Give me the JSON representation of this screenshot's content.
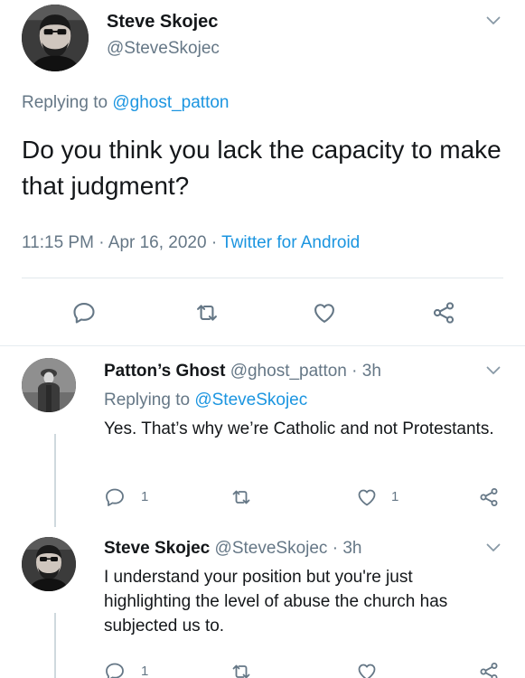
{
  "main_tweet": {
    "name": "Steve Skojec",
    "handle": "@SteveSkojec",
    "replying_prefix": "Replying to",
    "replying_handle": "@ghost_patton",
    "body": "Do you think you lack the capacity to make that judgment?",
    "time": "11:15 PM",
    "separator": "·",
    "date": "Apr 16, 2020",
    "source": "Twitter for Android"
  },
  "replies": [
    {
      "name": "Patton’s Ghost",
      "handle": "@ghost_patton",
      "separator": "·",
      "age": "3h",
      "replying_prefix": "Replying to",
      "replying_handle": "@SteveSkojec",
      "body": "Yes. That’s why we’re Catholic and not Protestants.",
      "reply_count": "1",
      "like_count": "1"
    },
    {
      "name": "Steve Skojec",
      "handle": "@SteveSkojec",
      "separator": "·",
      "age": "3h",
      "body": "I understand your position but you're just highlighting the level of abuse the church has subjected us to.",
      "reply_count": "1"
    }
  ],
  "icons": {
    "reply": "speech-bubble-icon",
    "retweet": "retweet-icon",
    "like": "heart-icon",
    "share": "share-icon",
    "more": "chevron-down-icon"
  },
  "colors": {
    "link": "#1b95e0",
    "muted": "#657786",
    "text": "#14171a",
    "divider": "#e1e8ed"
  }
}
